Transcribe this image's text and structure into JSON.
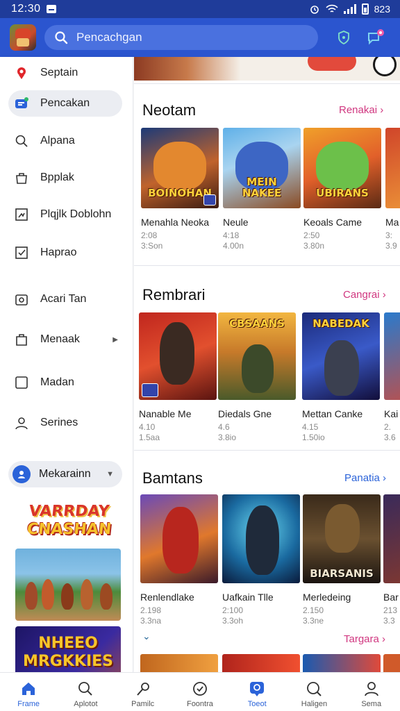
{
  "status_bar": {
    "time": "12:30",
    "battery": "823"
  },
  "app_bar": {
    "search_placeholder": "Pencachgan"
  },
  "drawer": {
    "items": [
      {
        "label": "Septain",
        "icon": "location-pin-icon"
      },
      {
        "label": "Pencakan",
        "icon": "chat-bubble-icon",
        "active": true
      },
      {
        "label": "Alpana",
        "icon": "search-icon"
      },
      {
        "label": "Bpplak",
        "icon": "bag-icon"
      },
      {
        "label": "Plqjlk Doblohn",
        "icon": "puzzle-icon"
      },
      {
        "label": "Haprao",
        "icon": "checkbox-icon"
      },
      {
        "label": "Acari Tan",
        "icon": "camera-icon"
      },
      {
        "label": "Menaak",
        "icon": "shopping-bag-icon",
        "has_submenu": true
      },
      {
        "label": "Madan",
        "icon": "square-icon"
      },
      {
        "label": "Serines",
        "icon": "person-icon"
      }
    ],
    "account_label": "Mekarainn",
    "promo_logo_line1": "VARRDAY",
    "promo_logo_line2": "CNASHAN",
    "promo_banner_text_line1": "NHEEO",
    "promo_banner_text_line2": "MRGKKIES"
  },
  "sections": [
    {
      "title": "Neotam",
      "link": "Renakai",
      "link_color": "#d0367f",
      "cards": [
        {
          "name": "Menahla Neoka",
          "rating": "2:08",
          "downloads": "3:Son",
          "art_text": "BOINOHAN"
        },
        {
          "name": "Neule",
          "rating": "4:18",
          "downloads": "4.00n",
          "art_text": "MEIN NAKEE"
        },
        {
          "name": "Keoals Came",
          "rating": "2:50",
          "downloads": "3.80n",
          "art_text": "UBIRANS"
        },
        {
          "name": "Ma",
          "rating": "3:",
          "downloads": "3.9",
          "art_text": ""
        }
      ]
    },
    {
      "title": "Rembrari",
      "link": "Cangrai",
      "link_color": "#d0367f",
      "cards": [
        {
          "name": "Nanable Me",
          "rating": "4.10",
          "downloads": "1.5aa",
          "art_text": ""
        },
        {
          "name": "Diedals Gne",
          "rating": "4.6",
          "downloads": "3.8io",
          "art_text": "CBSAANS"
        },
        {
          "name": "Mettan Canke",
          "rating": "4.15",
          "downloads": "1.50io",
          "art_text": "NABEDAK"
        },
        {
          "name": "Kai",
          "rating": "2.",
          "downloads": "3.6",
          "art_text": ""
        }
      ]
    },
    {
      "title": "Bamtans",
      "link": "Panatia",
      "link_color": "#2b63d9",
      "cards": [
        {
          "name": "Renlendlake",
          "rating": "2.198",
          "downloads": "3.3na",
          "art_text": ""
        },
        {
          "name": "Uafkain Tlle",
          "rating": "2:100",
          "downloads": "3.3oh",
          "art_text": ""
        },
        {
          "name": "Merledeing",
          "rating": "2.150",
          "downloads": "3.3ne",
          "art_text": "BIARSANIS"
        },
        {
          "name": "Bar",
          "rating": "213",
          "downloads": "3.3",
          "art_text": ""
        }
      ]
    }
  ],
  "more_link": "Targara",
  "bottom_nav": [
    {
      "label": "Frame",
      "icon": "home-icon",
      "active": true
    },
    {
      "label": "Aplotot",
      "icon": "search-icon"
    },
    {
      "label": "Pamilc",
      "icon": "wand-icon"
    },
    {
      "label": "Foontra",
      "icon": "check-circle-icon"
    },
    {
      "label": "Toeot",
      "icon": "chat-icon",
      "active": true
    },
    {
      "label": "Haligen",
      "icon": "search-icon"
    },
    {
      "label": "Sema",
      "icon": "person-icon"
    }
  ]
}
